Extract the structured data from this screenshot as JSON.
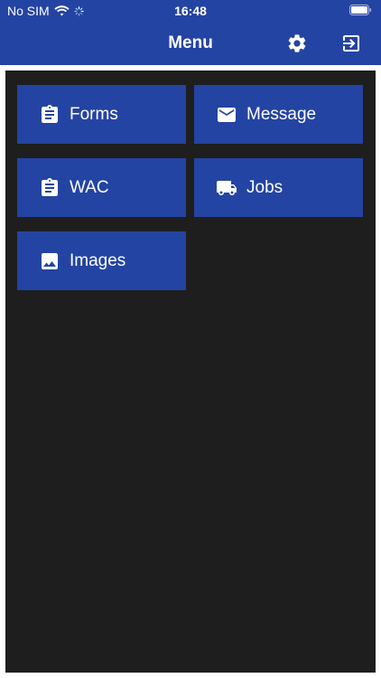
{
  "status_bar": {
    "carrier": "No SIM",
    "time": "16:48",
    "wifi_icon": "wifi-icon",
    "battery_icon": "battery-icon"
  },
  "header": {
    "title": "Menu",
    "settings_icon": "gear-icon",
    "logout_icon": "logout-icon"
  },
  "menu": {
    "tiles": [
      {
        "label": "Forms",
        "icon": "clipboard-icon"
      },
      {
        "label": "Message",
        "icon": "mail-icon"
      },
      {
        "label": "WAC",
        "icon": "clipboard-icon"
      },
      {
        "label": "Jobs",
        "icon": "truck-icon"
      },
      {
        "label": "Images",
        "icon": "image-icon"
      }
    ]
  },
  "colors": {
    "brand_blue": "#2444a3",
    "panel_bg": "#1e1e1e",
    "text": "#ffffff"
  }
}
